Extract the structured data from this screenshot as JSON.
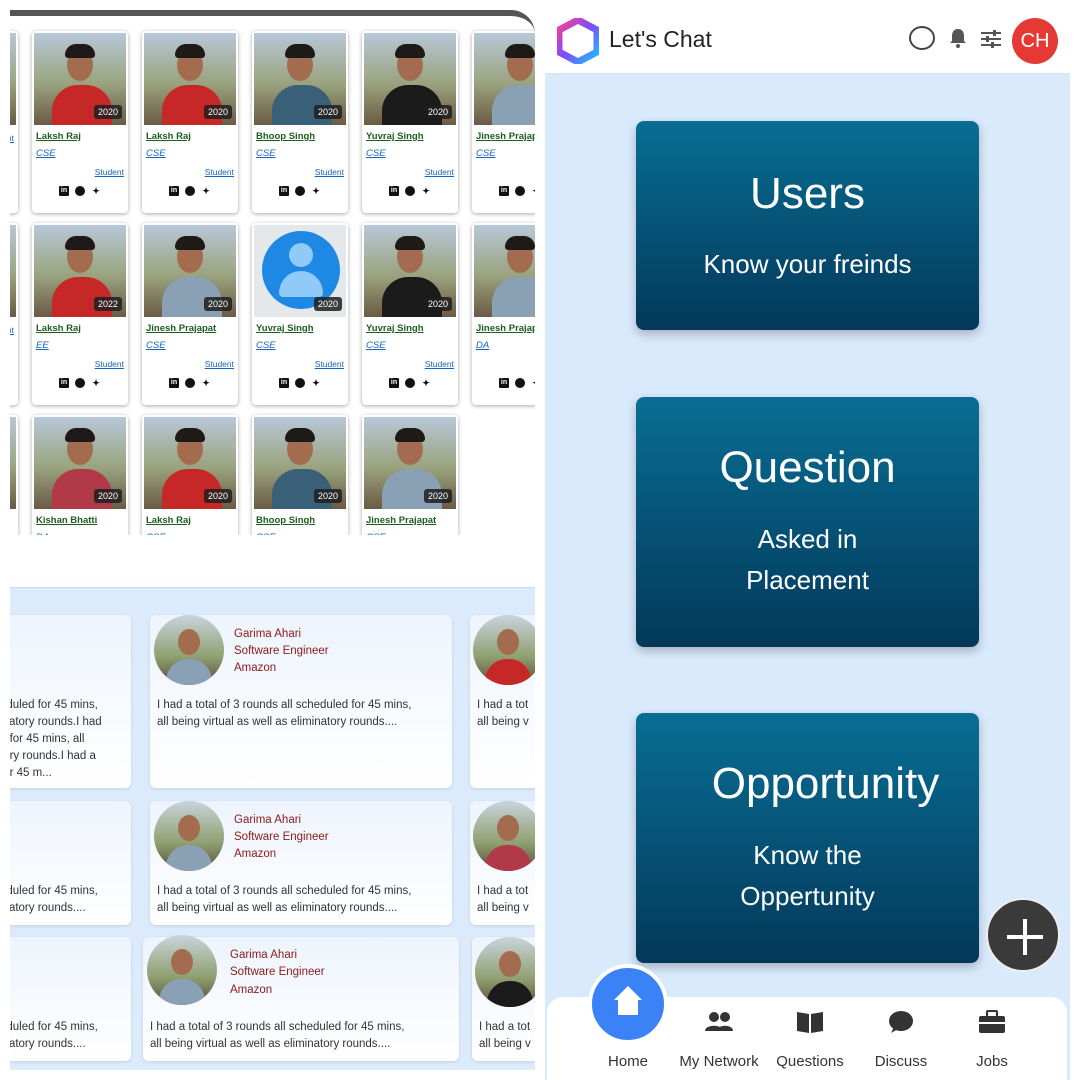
{
  "students": [
    [
      {
        "name": "",
        "branch": "",
        "role": "nt",
        "year": "",
        "shirt": "#7a6a5a"
      },
      {
        "name": "Laksh Raj",
        "branch": "CSE",
        "role": "Student",
        "year": "2020",
        "shirt": "#c62828"
      },
      {
        "name": "Laksh Raj",
        "branch": "CSE",
        "role": "Student",
        "year": "2020",
        "shirt": "#c62828"
      },
      {
        "name": "Bhoop Singh",
        "branch": "CSE",
        "role": "Student",
        "year": "2020",
        "shirt": "#3a5f78"
      },
      {
        "name": "Yuvraj Singh",
        "branch": "CSE",
        "role": "Student",
        "year": "2020",
        "shirt": "#1a1a1a"
      },
      {
        "name": "Jinesh Prajapat",
        "branch": "CSE",
        "role": "S",
        "year": "",
        "shirt": "#8aa0b5"
      }
    ],
    [
      {
        "name": "",
        "branch": "",
        "role": "nt",
        "year": "",
        "shirt": "#7a6a5a"
      },
      {
        "name": "Laksh Raj",
        "branch": "EE",
        "role": "Student",
        "year": "2022",
        "shirt": "#c62828"
      },
      {
        "name": "Jinesh Prajapat",
        "branch": "CSE",
        "role": "Student",
        "year": "2020",
        "shirt": "#8aa0b5"
      },
      {
        "name": "Yuvraj Singh",
        "branch": "CSE",
        "role": "Student",
        "year": "2020",
        "shirt": "avatar"
      },
      {
        "name": "Yuvraj Singh",
        "branch": "CSE",
        "role": "Student",
        "year": "2020",
        "shirt": "#1a1a1a"
      },
      {
        "name": "Jinesh Prajapat",
        "branch": "DA",
        "role": "S",
        "year": "",
        "shirt": "#8aa0b5"
      }
    ],
    [
      {
        "name": "",
        "branch": "",
        "role": "",
        "year": "",
        "shirt": "#d4a373"
      },
      {
        "name": "Kishan Bhatti",
        "branch": "DA",
        "role": "",
        "year": "2020",
        "shirt": "#b23a48"
      },
      {
        "name": "Laksh Raj",
        "branch": "CSE",
        "role": "",
        "year": "2020",
        "shirt": "#c62828"
      },
      {
        "name": "Bhoop Singh",
        "branch": "CSE",
        "role": "",
        "year": "2020",
        "shirt": "#3a5f78"
      },
      {
        "name": "Jinesh Prajapat",
        "branch": "CSE",
        "role": "",
        "year": "2020",
        "shirt": "#8aa0b5"
      }
    ]
  ],
  "experiences": {
    "left_partial": [
      {
        "meta": "er",
        "text": [
          "eduled for 45 mins,",
          "inatory rounds.I had",
          "d for 45 mins, all",
          "tory rounds.I had a",
          "for 45 m..."
        ]
      },
      {
        "meta": "er",
        "text": [
          "eduled for 45 mins,",
          "inatory rounds...."
        ]
      },
      {
        "meta": "er",
        "text": [
          "eduled for 45 mins,",
          "inatory rounds...."
        ]
      }
    ],
    "center": [
      {
        "name": "Garima Ahari",
        "title": "Software Engineer",
        "company": "Amazon",
        "text": [
          "I had a total of 3 rounds all scheduled for 45 mins,",
          "all being virtual as well as eliminatory rounds...."
        ]
      },
      {
        "name": "Garima Ahari",
        "title": "Software Engineer",
        "company": "Amazon",
        "text": [
          "I had a total of 3 rounds all scheduled for 45 mins,",
          "all being virtual as well as eliminatory rounds...."
        ]
      },
      {
        "name": "Garima Ahari",
        "title": "Software Engineer",
        "company": "Amazon",
        "text": [
          "I had a total of 3 rounds all scheduled for 45 mins,",
          "all being virtual as well as eliminatory rounds...."
        ]
      }
    ],
    "right_partial": [
      {
        "text": [
          "I had a tot",
          "all being v"
        ]
      },
      {
        "text": [
          "I had a tot",
          "all being v"
        ]
      },
      {
        "text": [
          "I had a tot",
          "all being v"
        ]
      }
    ]
  },
  "app": {
    "brand": "Let's Chat",
    "avatar_initials": "CH",
    "tiles": [
      {
        "title": "Users",
        "sub": [
          "Know your freinds"
        ]
      },
      {
        "title": "Question",
        "sub": [
          "Asked in",
          "Placement"
        ]
      },
      {
        "title": "Opportunity",
        "sub": [
          "Know the",
          "Oppertunity"
        ]
      }
    ],
    "nav": [
      "Home",
      "My Network",
      "Questions",
      "Discuss",
      "Jobs"
    ]
  }
}
